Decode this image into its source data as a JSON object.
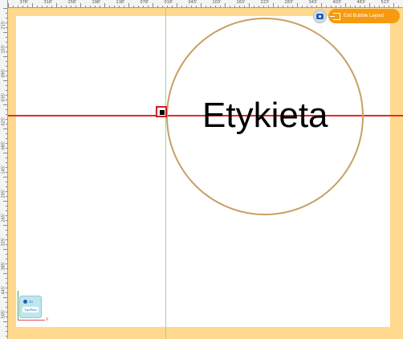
{
  "ruler": {
    "top": [
      "378'",
      "318'",
      "258'",
      "198'",
      "138'",
      "078'",
      "018'",
      "043'",
      "103'",
      "163'",
      "223'",
      "283'",
      "343'",
      "403'",
      "463'",
      "523'"
    ],
    "left": [
      "215'",
      "155'",
      "095'",
      "035'",
      "025'",
      "085'",
      "145'",
      "205'",
      "265'",
      "325'",
      "385'",
      "445'",
      "505'"
    ]
  },
  "toolbar": {
    "view_toggle_icon": "eye-icon",
    "exit_label": "Exit Bubble Layout",
    "exit_icon": "exit-icon"
  },
  "canvas": {
    "bubble_label": "Etykieta",
    "bubble_color": "#c8a063",
    "guide_horizontal_color": "#e32b2b",
    "guide_vertical_color": "#9fd39f"
  },
  "view_widget": {
    "mode": "2D",
    "plan": "Top/Plan",
    "axis_x": "X"
  }
}
